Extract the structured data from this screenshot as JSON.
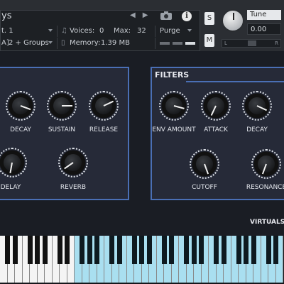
{
  "header": {
    "instrument_title": "ys",
    "output_value": "t. 1",
    "midi_value": "A]",
    "groups_value": "2 + Groups",
    "voices_label": "Voices:",
    "voices_value": "0",
    "max_label": "Max:",
    "max_value": "32",
    "memory_label": "Memory:",
    "memory_value": "1.39 MB",
    "purge_label": "Purge",
    "solo_label": "S",
    "mute_label": "M",
    "tune_label": "Tune",
    "tune_value": "0.00",
    "pan_left": "L",
    "pan_right": "R"
  },
  "left_panel": {
    "knobs": [
      {
        "label": "DECAY"
      },
      {
        "label": "SUSTAIN"
      },
      {
        "label": "RELEASE"
      },
      {
        "label": "DELAY"
      },
      {
        "label": "REVERB"
      }
    ]
  },
  "filters_panel": {
    "title": "FILTERS",
    "knobs": [
      {
        "label": "ENV AMOUNT"
      },
      {
        "label": "ATTACK"
      },
      {
        "label": "DECAY"
      },
      {
        "label": "CUTOFF"
      },
      {
        "label": "RESONANCE"
      }
    ]
  },
  "brand": "VIRTUALS",
  "colors": {
    "panel_border": "#4a6fb5",
    "key_highlight": "#a9dff0"
  }
}
